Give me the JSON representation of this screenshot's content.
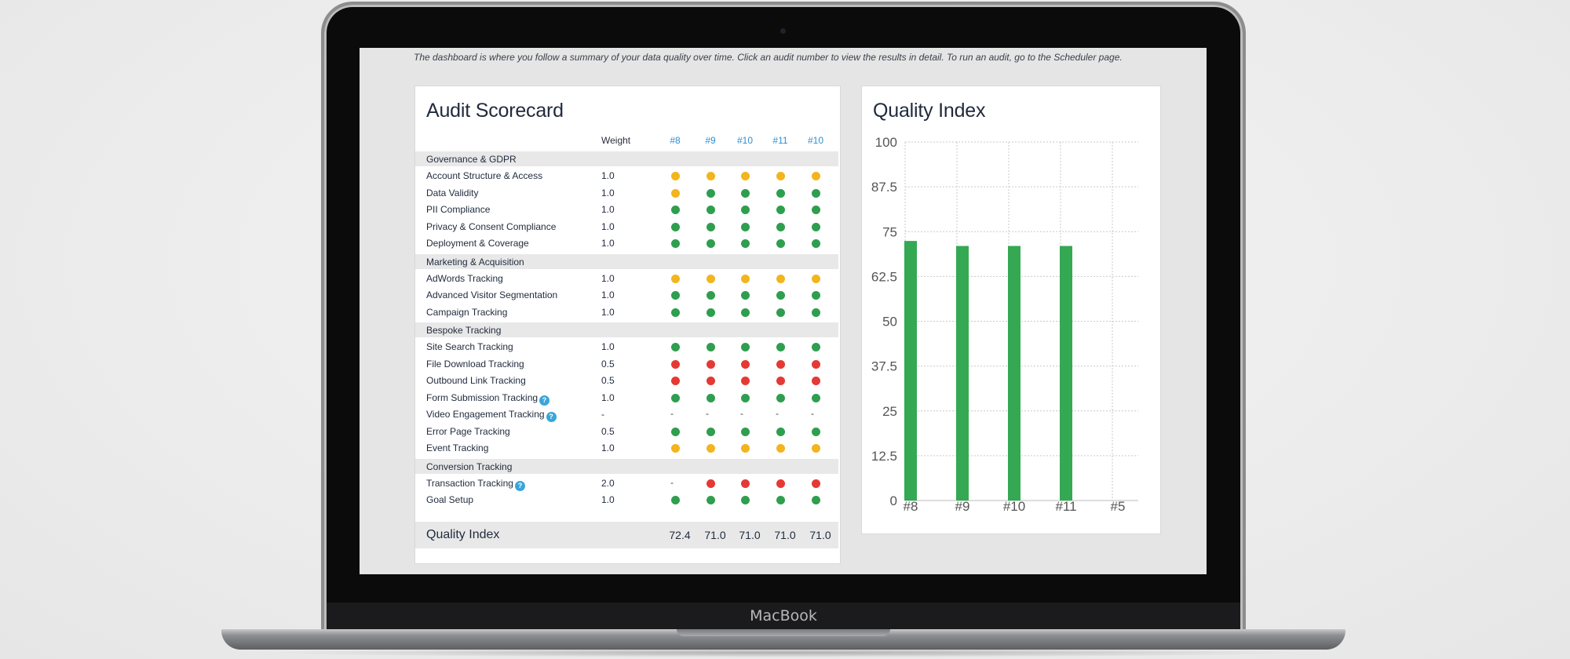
{
  "screen": {
    "intro": "The dashboard is where you follow a summary of your data quality over time. Click an audit number to view the results in detail. To run an audit, go to the Scheduler page."
  },
  "device": {
    "brand": "MacBook"
  },
  "colors": {
    "green": "#2e9e4f",
    "yellow": "#f2b51d",
    "red": "#e53935",
    "accent": "#2e8fd4",
    "bar": "#34a853"
  },
  "scorecard": {
    "title": "Audit Scorecard",
    "weight_label": "Weight",
    "audits": [
      "#8",
      "#9",
      "#10",
      "#11",
      "#10"
    ],
    "sections": [
      {
        "name": "Governance & GDPR",
        "rows": [
          {
            "label": "Account Structure & Access",
            "weight": "1.0",
            "help": false,
            "status": [
              "yellow",
              "yellow",
              "yellow",
              "yellow",
              "yellow"
            ]
          },
          {
            "label": "Data Validity",
            "weight": "1.0",
            "help": false,
            "status": [
              "yellow",
              "green",
              "green",
              "green",
              "green"
            ]
          },
          {
            "label": "PII Compliance",
            "weight": "1.0",
            "help": false,
            "status": [
              "green",
              "green",
              "green",
              "green",
              "green"
            ]
          },
          {
            "label": "Privacy & Consent Compliance",
            "weight": "1.0",
            "help": false,
            "status": [
              "green",
              "green",
              "green",
              "green",
              "green"
            ]
          },
          {
            "label": "Deployment & Coverage",
            "weight": "1.0",
            "help": false,
            "status": [
              "green",
              "green",
              "green",
              "green",
              "green"
            ]
          }
        ]
      },
      {
        "name": "Marketing & Acquisition",
        "rows": [
          {
            "label": "AdWords Tracking",
            "weight": "1.0",
            "help": false,
            "status": [
              "yellow",
              "yellow",
              "yellow",
              "yellow",
              "yellow"
            ]
          },
          {
            "label": "Advanced Visitor Segmentation",
            "weight": "1.0",
            "help": false,
            "status": [
              "green",
              "green",
              "green",
              "green",
              "green"
            ]
          },
          {
            "label": "Campaign Tracking",
            "weight": "1.0",
            "help": false,
            "status": [
              "green",
              "green",
              "green",
              "green",
              "green"
            ]
          }
        ]
      },
      {
        "name": "Bespoke Tracking",
        "rows": [
          {
            "label": "Site Search Tracking",
            "weight": "1.0",
            "help": false,
            "status": [
              "green",
              "green",
              "green",
              "green",
              "green"
            ]
          },
          {
            "label": "File Download Tracking",
            "weight": "0.5",
            "help": false,
            "status": [
              "red",
              "red",
              "red",
              "red",
              "red"
            ]
          },
          {
            "label": "Outbound Link Tracking",
            "weight": "0.5",
            "help": false,
            "status": [
              "red",
              "red",
              "red",
              "red",
              "red"
            ]
          },
          {
            "label": "Form Submission Tracking",
            "weight": "1.0",
            "help": true,
            "status": [
              "green",
              "green",
              "green",
              "green",
              "green"
            ]
          },
          {
            "label": "Video Engagement Tracking",
            "weight": "-",
            "help": true,
            "status": [
              "-",
              "-",
              "-",
              "-",
              "-"
            ]
          },
          {
            "label": "Error Page Tracking",
            "weight": "0.5",
            "help": false,
            "status": [
              "green",
              "green",
              "green",
              "green",
              "green"
            ]
          },
          {
            "label": "Event Tracking",
            "weight": "1.0",
            "help": false,
            "status": [
              "yellow",
              "yellow",
              "yellow",
              "yellow",
              "yellow"
            ]
          }
        ]
      },
      {
        "name": "Conversion Tracking",
        "rows": [
          {
            "label": "Transaction Tracking",
            "weight": "2.0",
            "help": true,
            "status": [
              "-",
              "red",
              "red",
              "red",
              "red"
            ]
          },
          {
            "label": "Goal Setup",
            "weight": "1.0",
            "help": false,
            "status": [
              "green",
              "green",
              "green",
              "green",
              "green"
            ]
          }
        ]
      }
    ],
    "help_glyph": "?",
    "quality_index": {
      "label": "Quality Index",
      "values": [
        "72.4",
        "71.0",
        "71.0",
        "71.0",
        "71.0"
      ]
    }
  },
  "quality_chart": {
    "title": "Quality Index"
  },
  "chart_data": {
    "type": "bar",
    "title": "Quality Index",
    "categories": [
      "#8",
      "#9",
      "#10",
      "#11",
      "#5"
    ],
    "values": [
      72.4,
      71.0,
      71.0,
      71.0,
      null
    ],
    "yticks": [
      "0",
      "12.5",
      "25",
      "37.5",
      "50",
      "62.5",
      "75",
      "87.5",
      "100"
    ],
    "ylim": [
      0,
      100
    ],
    "grid": true,
    "xlabel": "",
    "ylabel": ""
  }
}
